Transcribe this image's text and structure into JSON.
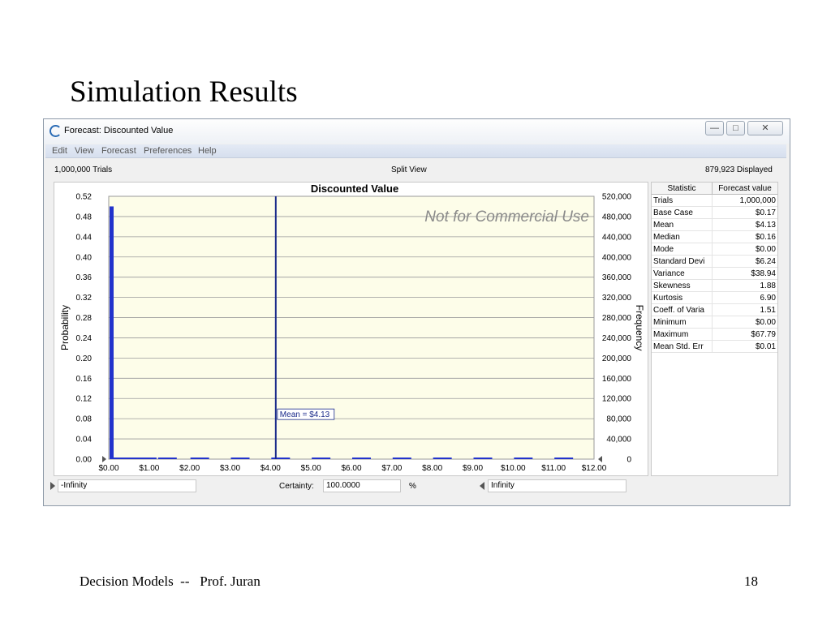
{
  "slide": {
    "title": "Simulation Results",
    "footer_left": "Decision Models  --   Prof. Juran",
    "page_number": "18"
  },
  "window": {
    "title": "Forecast: Discounted Value",
    "menu": [
      "Edit",
      "View",
      "Forecast",
      "Preferences",
      "Help"
    ],
    "trials_text": "1,000,000 Trials",
    "view_text": "Split View",
    "displayed_text": "879,923 Displayed"
  },
  "chart_data": {
    "type": "bar",
    "title": "Discounted Value",
    "watermark": "Not for Commercial Use",
    "xlabel": "",
    "ylabel_left": "Probability",
    "ylabel_right": "Frequency",
    "x_ticks": [
      "$0.00",
      "$1.00",
      "$2.00",
      "$3.00",
      "$4.00",
      "$5.00",
      "$6.00",
      "$7.00",
      "$8.00",
      "$9.00",
      "$10.00",
      "$11.00",
      "$12.00"
    ],
    "y_ticks_left": [
      "0.00",
      "0.04",
      "0.08",
      "0.12",
      "0.16",
      "0.20",
      "0.24",
      "0.28",
      "0.32",
      "0.36",
      "0.40",
      "0.44",
      "0.48",
      "0.52"
    ],
    "y_ticks_right": [
      "0",
      "40,000",
      "80,000",
      "120,000",
      "160,000",
      "200,000",
      "240,000",
      "280,000",
      "320,000",
      "360,000",
      "400,000",
      "440,000",
      "480,000",
      "520,000"
    ],
    "xlim": [
      0,
      12
    ],
    "ylim": [
      0,
      0.52
    ],
    "bins": [
      {
        "x": 0.0,
        "y": 0.5
      },
      {
        "x": 0.1,
        "y": 0.003
      },
      {
        "x": 0.3,
        "y": 0.003
      },
      {
        "x": 0.5,
        "y": 0.003
      },
      {
        "x": 0.7,
        "y": 0.002
      },
      {
        "x": 1.2,
        "y": 0.002
      },
      {
        "x": 2.0,
        "y": 0.0015
      },
      {
        "x": 3.0,
        "y": 0.0015
      },
      {
        "x": 4.0,
        "y": 0.0015
      },
      {
        "x": 5.0,
        "y": 0.001
      },
      {
        "x": 6.0,
        "y": 0.001
      },
      {
        "x": 7.0,
        "y": 0.0008
      },
      {
        "x": 8.0,
        "y": 0.0008
      },
      {
        "x": 9.0,
        "y": 0.0006
      },
      {
        "x": 10.0,
        "y": 0.0005
      },
      {
        "x": 11.0,
        "y": 0.0004
      }
    ],
    "mean_value": 4.13,
    "mean_label": "Mean = $4.13",
    "colors": {
      "bar": "#2233cc",
      "plot_bg": "#fdfde9",
      "mean_line": "#1a2a8a",
      "watermark": "#8a8a8a"
    }
  },
  "statistics": {
    "headers": [
      "Statistic",
      "Forecast value"
    ],
    "rows": [
      [
        "Trials",
        "1,000,000"
      ],
      [
        "Base Case",
        "$0.17"
      ],
      [
        "Mean",
        "$4.13"
      ],
      [
        "Median",
        "$0.16"
      ],
      [
        "Mode",
        "$0.00"
      ],
      [
        "Standard Devi",
        "$6.24"
      ],
      [
        "Variance",
        "$38.94"
      ],
      [
        "Skewness",
        "1.88"
      ],
      [
        "Kurtosis",
        "6.90"
      ],
      [
        "Coeff. of Varia",
        "1.51"
      ],
      [
        "Minimum",
        "$0.00"
      ],
      [
        "Maximum",
        "$67.79"
      ],
      [
        "Mean Std. Err",
        "$0.01"
      ]
    ]
  },
  "certainty": {
    "left_value": "-Infinity",
    "label": "Certainty:",
    "value": "100.0000",
    "unit": "%",
    "right_value": "Infinity"
  }
}
